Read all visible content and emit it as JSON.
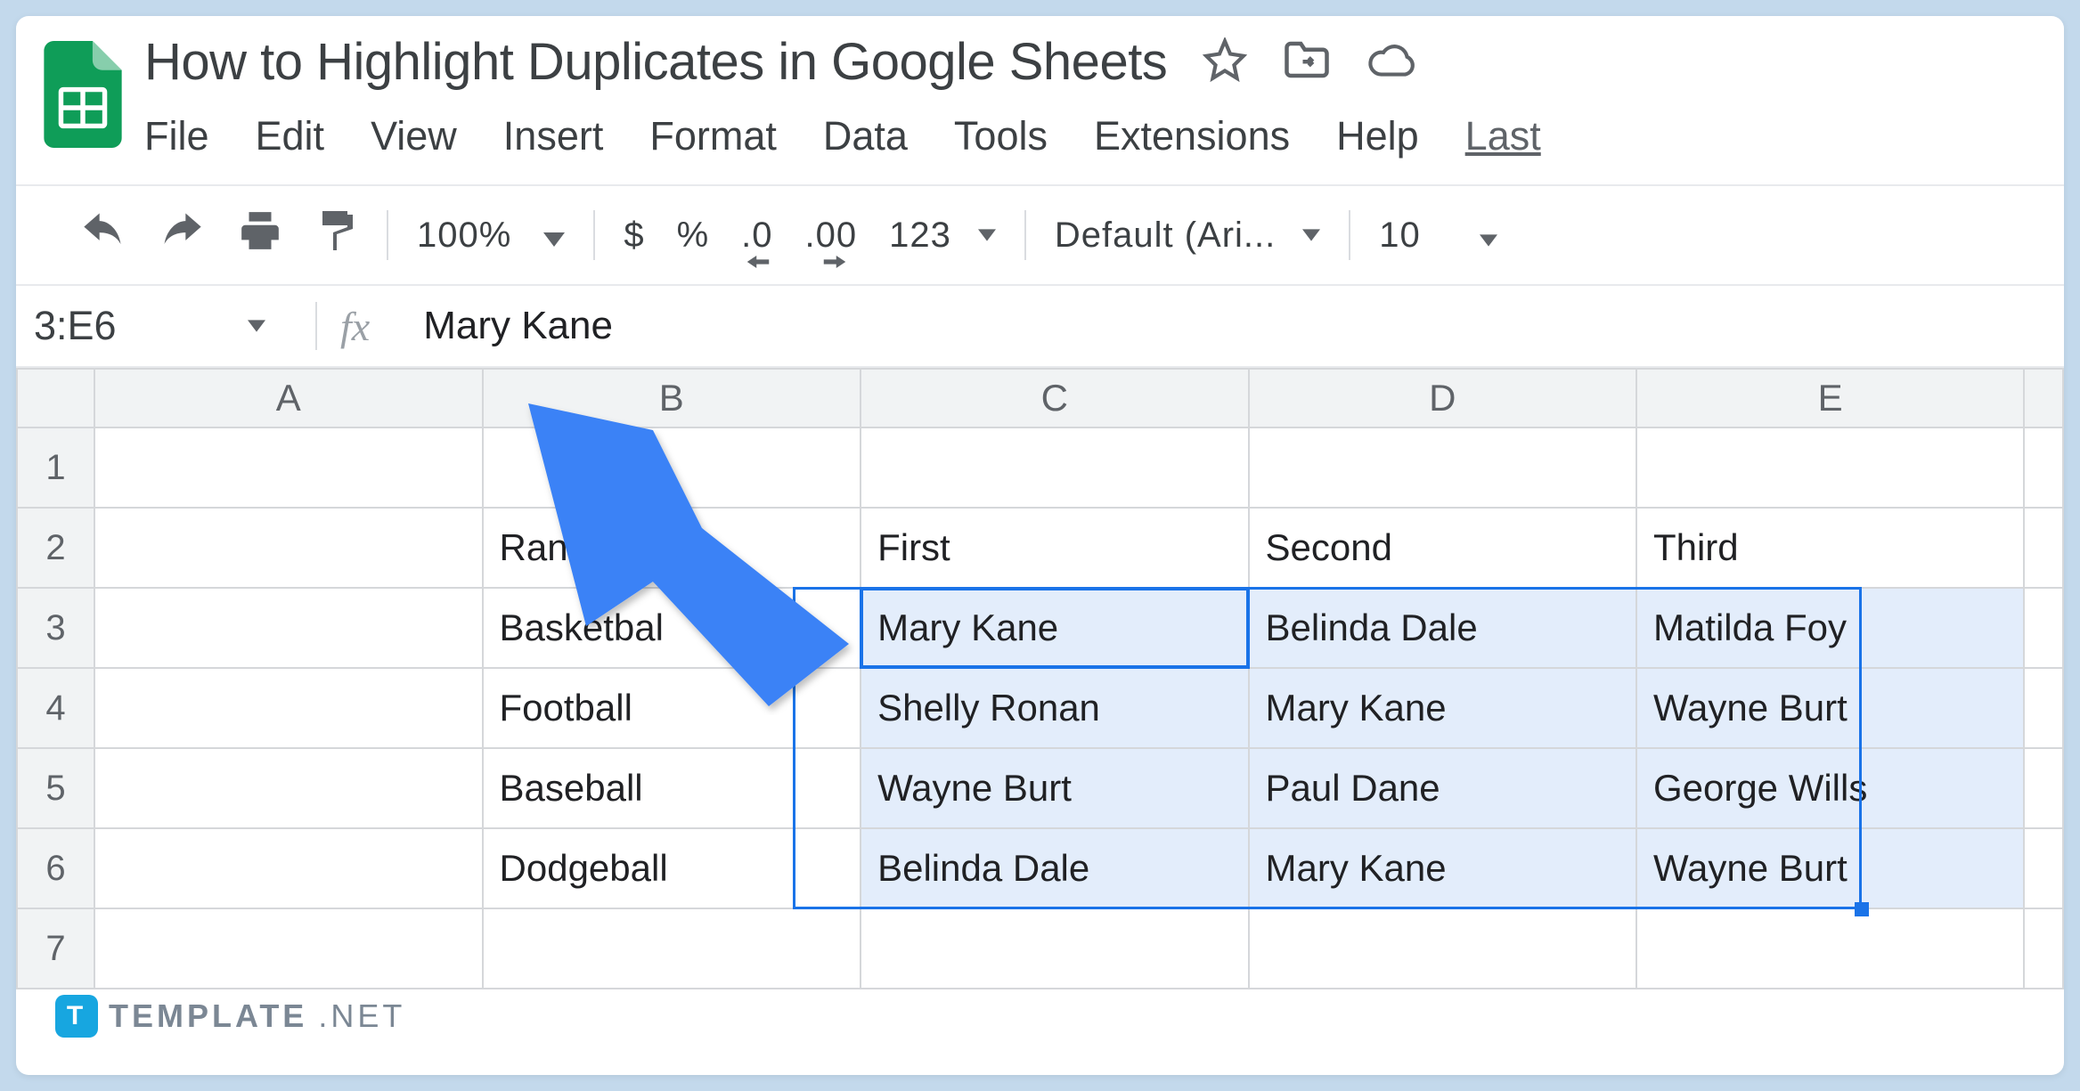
{
  "doc": {
    "title": "How to Highlight Duplicates in Google Sheets"
  },
  "menu": {
    "file": "File",
    "edit": "Edit",
    "view": "View",
    "insert": "Insert",
    "format": "Format",
    "data": "Data",
    "tools": "Tools",
    "extensions": "Extensions",
    "help": "Help",
    "last": "Last"
  },
  "toolbar": {
    "zoom": "100%",
    "currency": "$",
    "percent": "%",
    "dec_dec": ".0",
    "dec_inc": ".00",
    "num_fmt": "123",
    "font": "Default (Ari...",
    "font_size": "10"
  },
  "formula": {
    "name_box": "3:E6",
    "value": "Mary Kane"
  },
  "columns": {
    "a": "A",
    "b": "B",
    "c": "C",
    "d": "D",
    "e": "E"
  },
  "rows": {
    "r1": "1",
    "r2": "2",
    "r3": "3",
    "r4": "4",
    "r5": "5",
    "r6": "6",
    "r7": "7"
  },
  "cells": {
    "b2": "Ranking",
    "c2": "First",
    "d2": "Second",
    "e2": "Third",
    "b3": "Basketbal",
    "c3": "Mary Kane",
    "d3": "Belinda Dale",
    "e3": "Matilda Foy",
    "b4": "Football",
    "c4": "Shelly Ronan",
    "d4": "Mary Kane",
    "e4": "Wayne Burt",
    "b5": "Baseball",
    "c5": "Wayne Burt",
    "d5": "Paul Dane",
    "e5": "George Wills",
    "b6": "Dodgeball",
    "c6": "Belinda Dale",
    "d6": "Mary Kane",
    "e6": "Wayne Burt"
  },
  "watermark": {
    "text": "TEMPLATE",
    "suffix": ".NET"
  }
}
